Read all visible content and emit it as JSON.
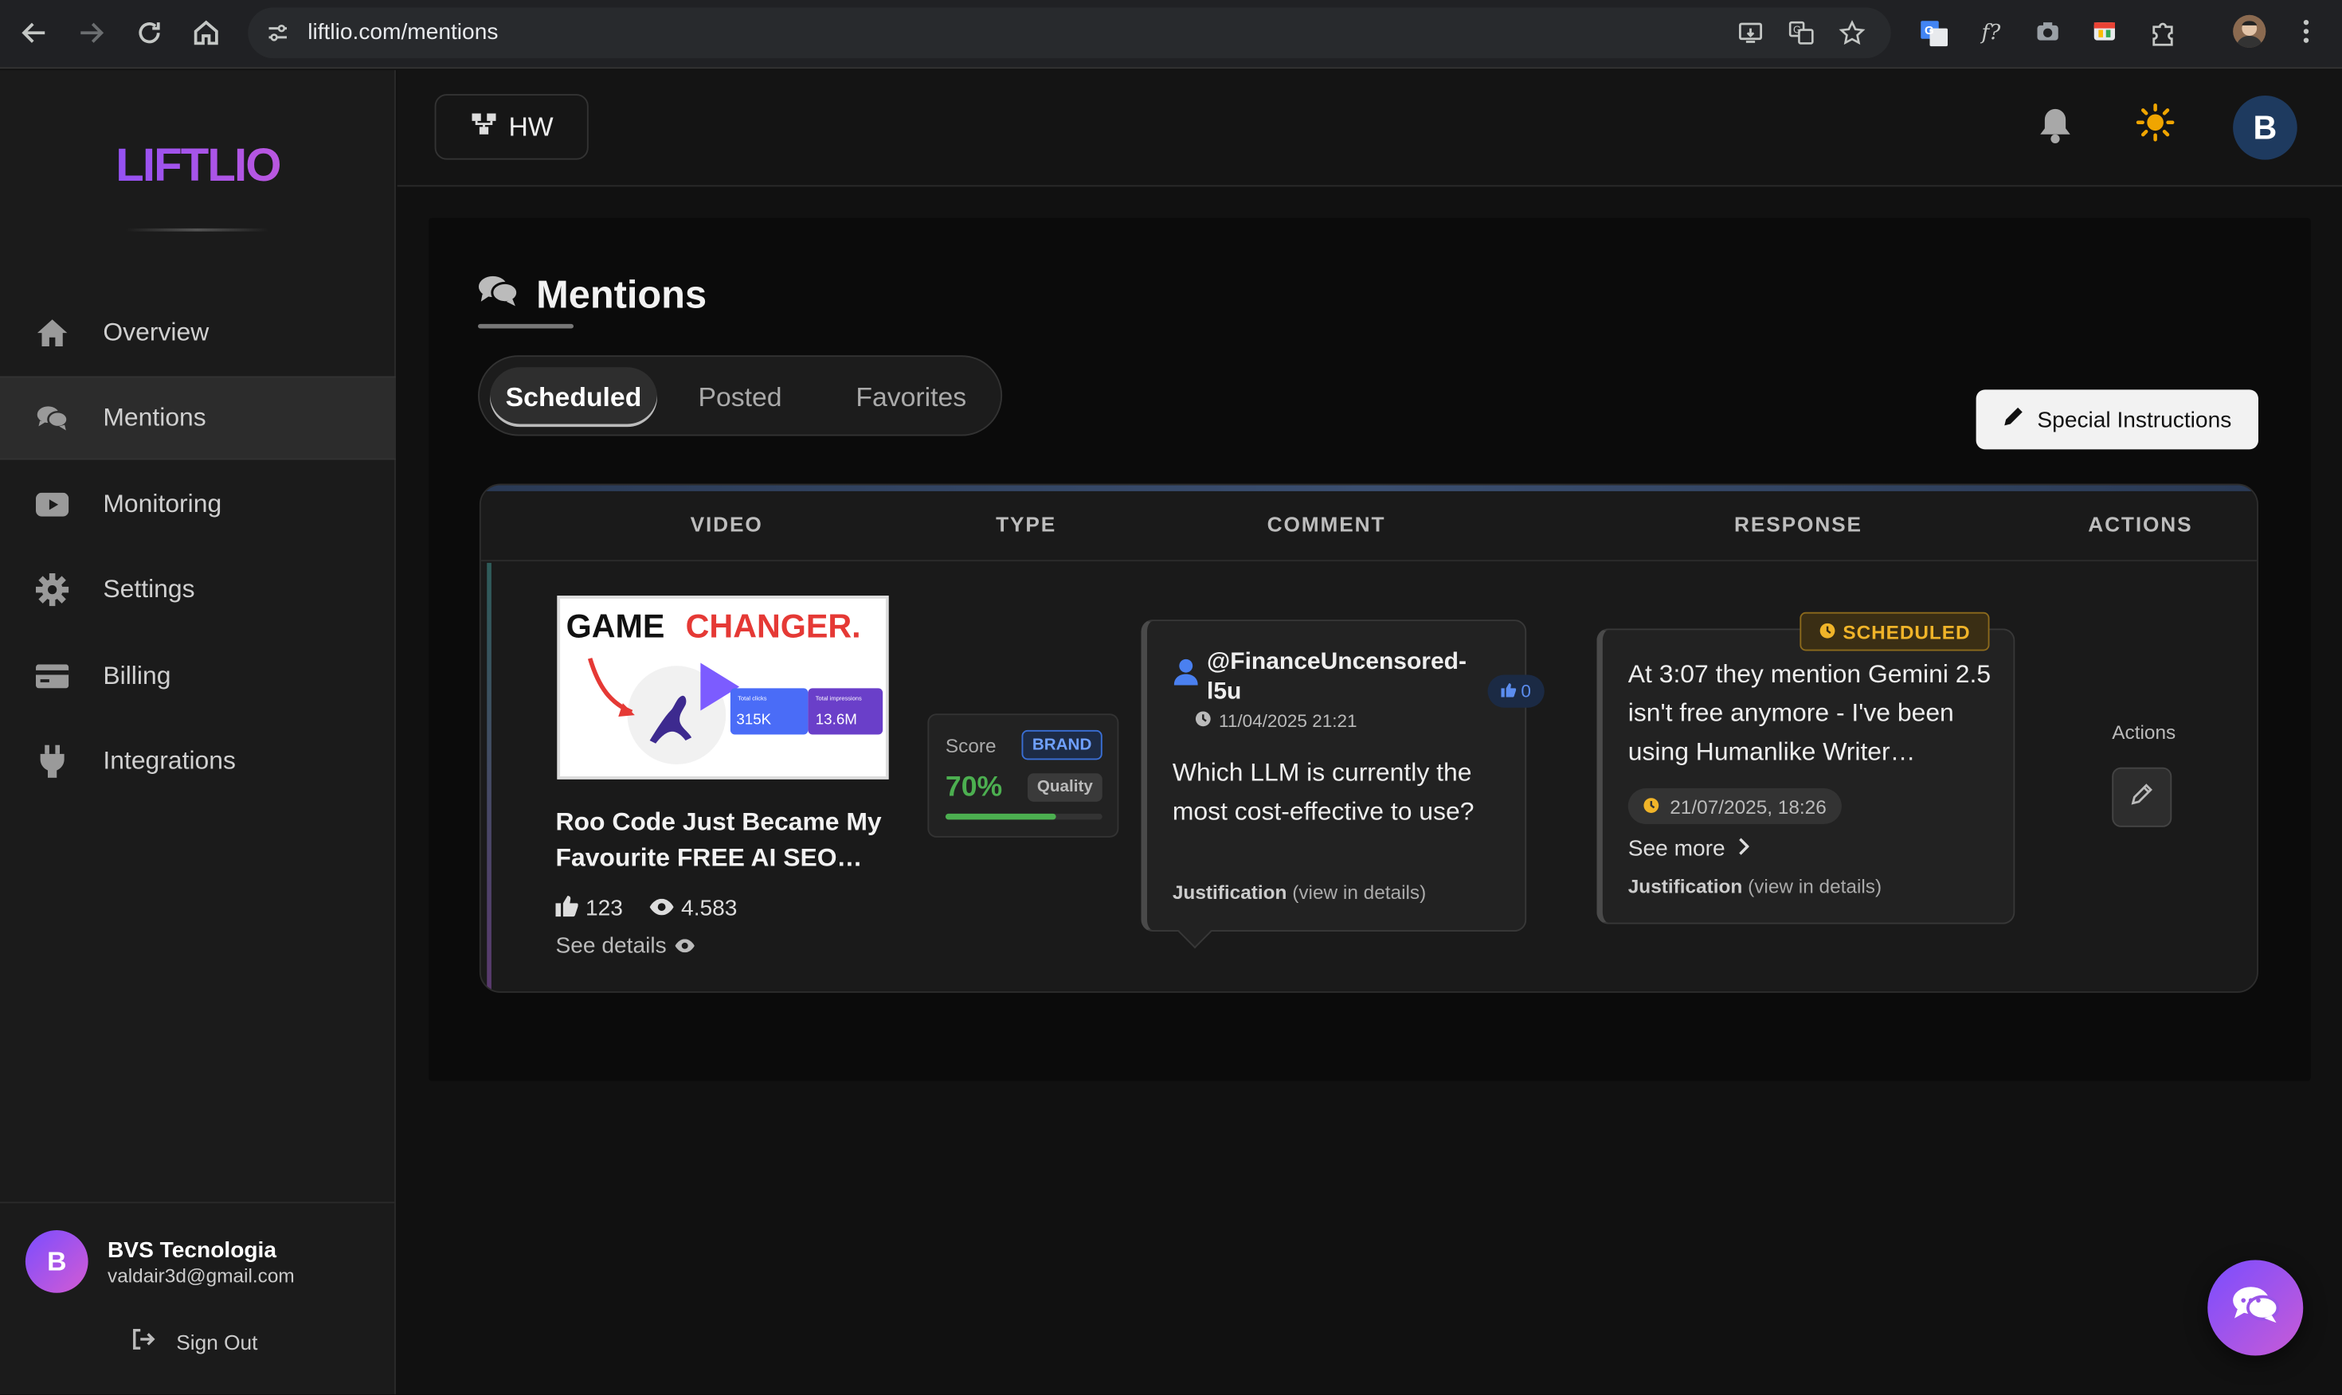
{
  "browser": {
    "url": "liftlio.com/mentions"
  },
  "sidebar": {
    "logo": "LIFTLIO",
    "items": [
      {
        "label": "Overview",
        "icon": "home-icon"
      },
      {
        "label": "Mentions",
        "icon": "comments-icon",
        "active": true
      },
      {
        "label": "Monitoring",
        "icon": "youtube-icon"
      },
      {
        "label": "Settings",
        "icon": "gear-icon"
      },
      {
        "label": "Billing",
        "icon": "credit-card-icon"
      },
      {
        "label": "Integrations",
        "icon": "plug-icon"
      }
    ],
    "user": {
      "initial": "B",
      "name": "BVS Tecnologia",
      "email": "valdair3d@gmail.com",
      "signout": "Sign Out"
    }
  },
  "topbar": {
    "project": "HW",
    "avatar_initial": "B"
  },
  "page": {
    "title": "Mentions",
    "tabs": [
      "Scheduled",
      "Posted",
      "Favorites"
    ],
    "active_tab": "Scheduled",
    "special_instructions": "Special Instructions"
  },
  "table": {
    "headers": [
      "VIDEO",
      "TYPE",
      "COMMENT",
      "RESPONSE",
      "ACTIONS"
    ],
    "row": {
      "video": {
        "thumb_game": "GAME",
        "thumb_changer": "CHANGER.",
        "thumb_stat1_label": "Total clicks",
        "thumb_stat1": "315K",
        "thumb_stat2_label": "Total impressions",
        "thumb_stat2": "13.6M",
        "title": "Roo Code Just Became My Favourite FREE AI SEO…",
        "likes": "123",
        "views": "4.583",
        "see_details": "See details"
      },
      "type": {
        "score_label": "Score",
        "badge": "BRAND",
        "score": "70%",
        "score_fraction": 0.7,
        "quality": "Quality"
      },
      "comment": {
        "author": "@FinanceUncensored-l5u",
        "likes": "0",
        "date": "11/04/2025 21:21",
        "text": "Which LLM is currently the most cost-effective to use?",
        "justification": "Justification",
        "view": "(view in details)"
      },
      "response": {
        "status": "SCHEDULED",
        "text": "At 3:07 they mention Gemini 2.5 isn't free anymore - I've been using Humanlike Writer…",
        "date": "21/07/2025, 18:26",
        "see_more": "See more",
        "justification": "Justification",
        "view": "(view in details)"
      },
      "actions_label": "Actions"
    }
  },
  "colors": {
    "accent_gradient_start": "#7a4dff",
    "accent_gradient_end": "#d45bd3",
    "score_green": "#4caf50",
    "scheduled_amber": "#f0b429",
    "brand_blue": "#6fa0ff"
  }
}
